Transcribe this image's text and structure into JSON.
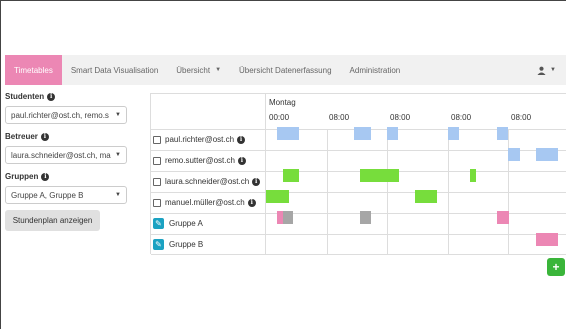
{
  "nav": {
    "items": [
      {
        "label": "Timetables",
        "active": true
      },
      {
        "label": "Smart Data Visualisation"
      },
      {
        "label": "Übersicht",
        "dropdown": true
      },
      {
        "label": "Übersicht Datenerfassung"
      },
      {
        "label": "Administration"
      }
    ],
    "user_icon": "user-icon"
  },
  "sidebar": {
    "studenten_label": "Studenten",
    "studenten_value": "paul.richter@ost.ch, remo.s",
    "betreuer_label": "Betreuer",
    "betreuer_value": "laura.schneider@ost.ch, ma",
    "gruppen_label": "Gruppen",
    "gruppen_value": "Gruppe A, Gruppe B",
    "show_button": "Stundenplan anzeigen"
  },
  "timetable": {
    "day": "Montag",
    "times": [
      "00:00",
      "08:00",
      "08:00",
      "08:00",
      "08:00"
    ],
    "rows": [
      {
        "label": "paul.richter@ost.ch",
        "kind": "person"
      },
      {
        "label": "remo.sutter@ost.ch",
        "kind": "person"
      },
      {
        "label": "laura.schneider@ost.ch",
        "kind": "person"
      },
      {
        "label": "manuel.müller@ost.ch",
        "kind": "person"
      },
      {
        "label": "Gruppe A",
        "kind": "group"
      },
      {
        "label": "Gruppe B",
        "kind": "group"
      }
    ]
  },
  "colors": {
    "accent": "#ec87b4",
    "blue": "#a7c8f2",
    "green": "#77dd3c",
    "gray": "#a6a6a6",
    "pink": "#ec87b4",
    "add": "#3ab53a"
  }
}
